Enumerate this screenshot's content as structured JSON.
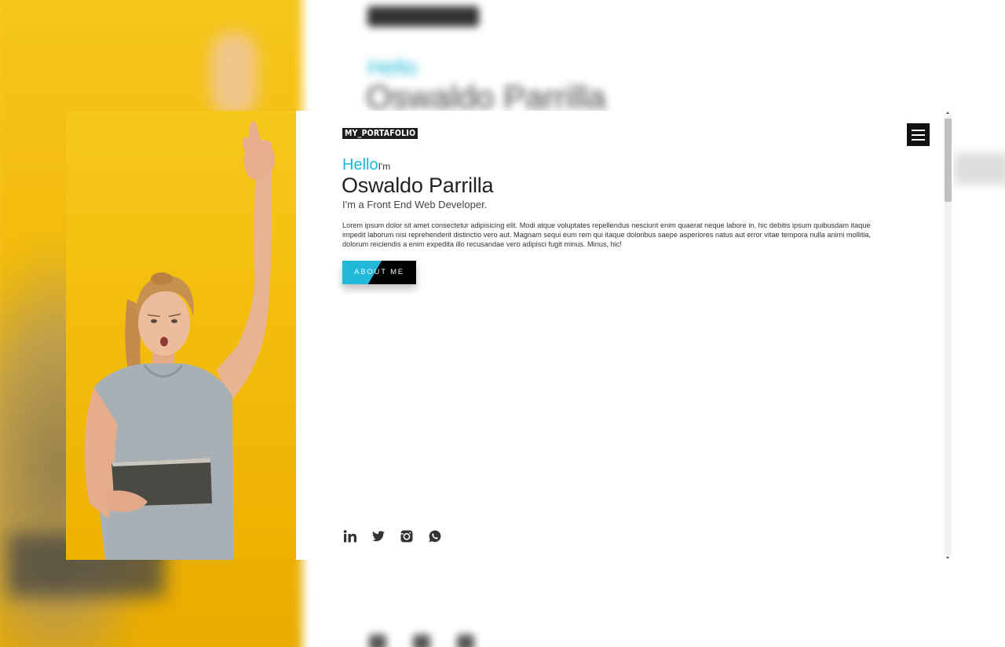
{
  "brand": "MY_PORTAFOLIO",
  "hero": {
    "hello": "Hello",
    "im": "I'm",
    "name": "Oswaldo Parrilla",
    "tagline": "I'm a Front End Web Developer.",
    "bio": "Lorem ipsum dolor sit amet consectetur adipisicing elit. Modi atque voluptates repellendus nesciunt enim quaerat neque labore in, hic debitis ipsum quibusdam itaque impedit laborum nisi reprehenderit distinctio vero aut. Magnam sequi eum rem qui itaque doloribus saepe asperiores natus aut error vitae tempora nulla animi mollitia, dolorum reiciendis a enim expedita illo recusandae vero adipisci fugit minus. Minus, hic!",
    "cta": "ABOUT ME"
  },
  "socials": [
    {
      "icon": "linkedin-icon"
    },
    {
      "icon": "twitter-icon"
    },
    {
      "icon": "instagram-icon"
    },
    {
      "icon": "whatsapp-icon"
    }
  ],
  "colors": {
    "accent": "#1cb7d7",
    "background_yellow": "#f3bc0c",
    "dark": "#111111"
  }
}
